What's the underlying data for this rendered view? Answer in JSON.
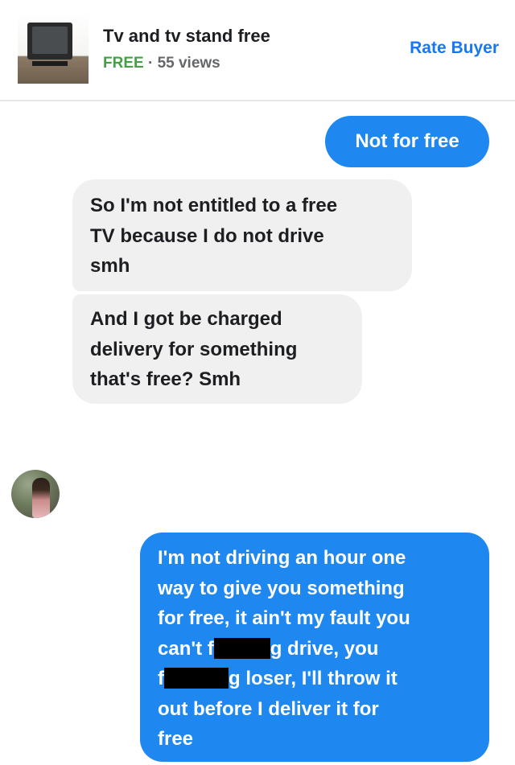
{
  "header": {
    "title": "Tv and tv stand free",
    "price": "FREE",
    "separator": " · ",
    "views": "55 views",
    "rate_buyer": "Rate Buyer"
  },
  "messages": {
    "m1": "Not for free",
    "m2": "So I'm not entitled to a free\nTV because I do not drive\nsmh",
    "m3": "And I got be charged\ndelivery for something\nthat's free? Smh",
    "m4": {
      "line1": "I'm not driving an hour one",
      "line2": "way to give you something",
      "line3": "for free, it ain't my fault you",
      "line4_start": "can't f",
      "line4_end": "g drive, you",
      "line5_start": "f",
      "line5_end": "g loser, I'll throw it",
      "line6": "out before I deliver it for",
      "line7": "free"
    }
  },
  "colors": {
    "outgoing_bubble": "#1e87f0",
    "incoming_bubble": "#f0f0f0",
    "accent_link": "#1877f2",
    "price_green": "#43a047"
  },
  "icons": {
    "listing_thumbnail": "tv-thumbnail",
    "avatar": "user-avatar"
  }
}
